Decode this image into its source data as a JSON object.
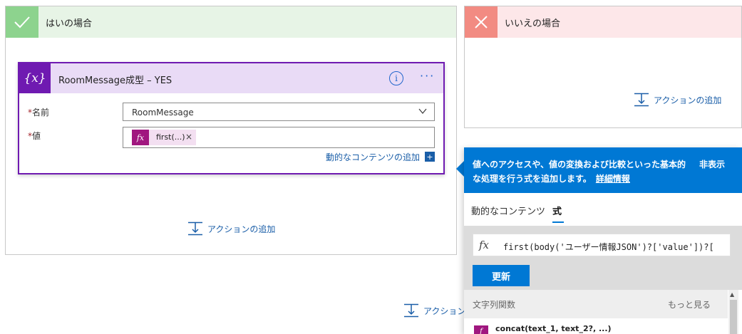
{
  "yes_branch": {
    "title": "はいの場合",
    "card": {
      "title": "RoomMessage成型 – YES",
      "name_label": "名前",
      "value_label": "値",
      "required_mark": "*",
      "name_value": "RoomMessage",
      "token_label": "first(...)",
      "token_remove": "×",
      "dynamic_content_link": "動的なコンテンツの追加",
      "info_glyph": "i",
      "more_glyph": "···"
    },
    "add_action_label": "アクションの追加"
  },
  "no_branch": {
    "title": "いいえの場合",
    "add_action_label": "アクションの追加"
  },
  "bottom_add_action_label": "アクション",
  "popup": {
    "banner_text": "値へのアクセスや、値の変換および比較といった基本的な処理を行う式を追加します。",
    "banner_link": "詳細情報",
    "hide_label": "非表示",
    "tabs": [
      "動的なコンテンツ",
      "式"
    ],
    "active_tab": "式",
    "expression": "first(body('ユーザー情報JSON')?['value'])?[",
    "update_button": "更新",
    "functions_section": "文字列関数",
    "see_more": "もっと見る",
    "first_function": "concat(text_1, text_2?, ...)"
  },
  "colors": {
    "yes_accent": "#8dd38e",
    "no_accent": "#f28b82",
    "card_purple": "#6f1ab1",
    "token_magenta": "#a0177f",
    "link_blue": "#1a5ea8",
    "banner_blue": "#0078d4"
  },
  "icons": {
    "yes": "check-icon",
    "no": "close-icon",
    "card": "variable-icon",
    "token": "fx-icon",
    "info": "info-icon",
    "more": "more-icon",
    "add": "add-action-icon",
    "chevron": "chevron-down-icon"
  }
}
